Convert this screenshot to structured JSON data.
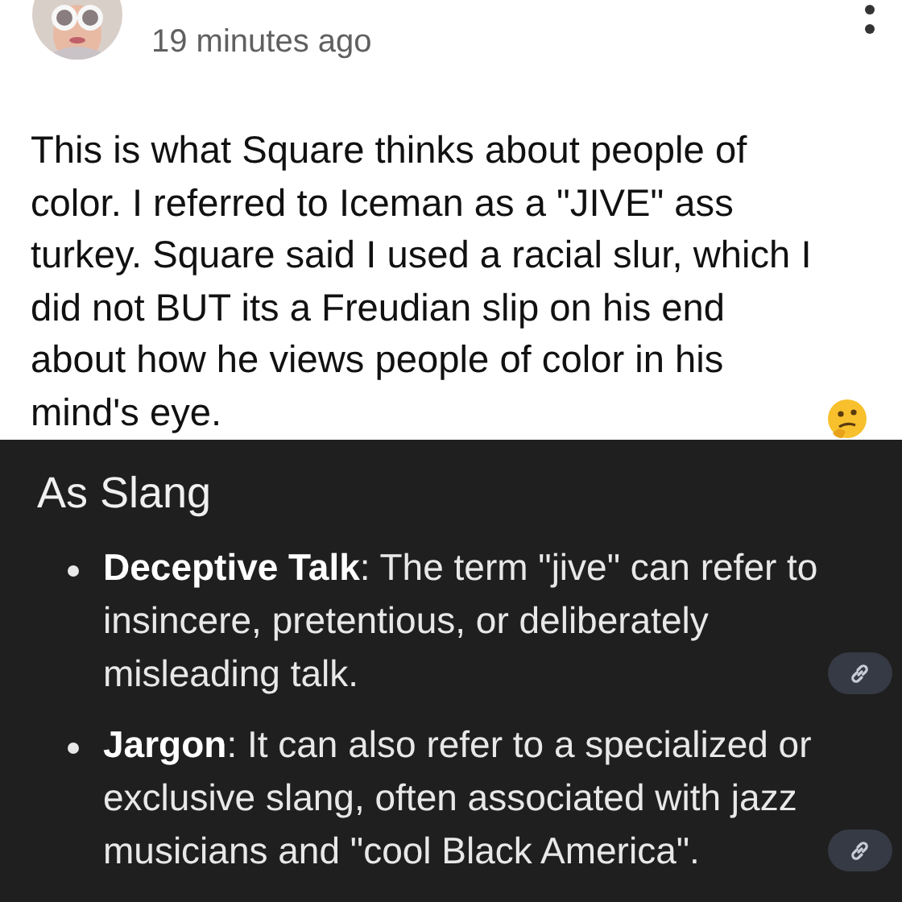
{
  "post": {
    "timestamp": "19 minutes ago",
    "body": "This is what Square thinks about people of color. I referred to Iceman as a \"JIVE\" ass turkey. Square said I used a racial slur, which I did not BUT its a Freudian slip on his end about how he views people of color in his mind's eye."
  },
  "definition_panel": {
    "heading": "As Slang",
    "bullets": [
      {
        "term": "Deceptive Talk",
        "text": ": The term \"jive\" can refer to insincere, pretentious, or deliberately misleading talk.",
        "source_link": true
      },
      {
        "term": "Jargon",
        "text": ": It can also refer to a specialized or exclusive slang, often associated with jazz musicians and \"cool Black America\".",
        "source_link": true
      }
    ]
  }
}
